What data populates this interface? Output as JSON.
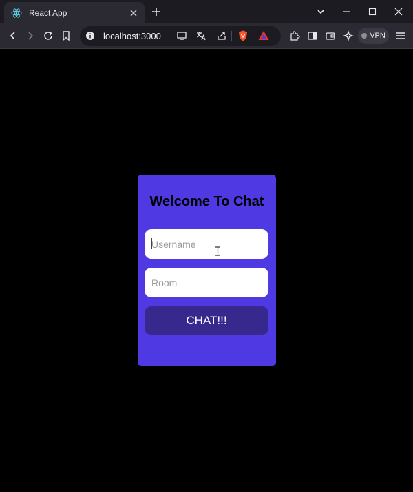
{
  "browser": {
    "tab_title": "React App",
    "url": "localhost:3000",
    "vpn_label": "VPN"
  },
  "form": {
    "title": "Welcome To Chat",
    "username_placeholder": "Username",
    "username_value": "",
    "room_placeholder": "Room",
    "room_value": "",
    "button_label": "CHAT!!!"
  },
  "colors": {
    "card": "#4f39e2",
    "button": "#37288e",
    "page_background": "#000000"
  },
  "icons": [
    "react-icon",
    "close-icon",
    "plus-icon",
    "chevron-down-icon",
    "minimize-icon",
    "maximize-icon",
    "back-icon",
    "forward-icon",
    "reload-icon",
    "bookmark-icon",
    "info-icon",
    "cast-icon",
    "translate-icon",
    "share-icon",
    "brave-shield-icon",
    "brave-rewards-icon",
    "extensions-icon",
    "sidebar-icon",
    "wallet-icon",
    "leo-icon",
    "menu-icon"
  ]
}
